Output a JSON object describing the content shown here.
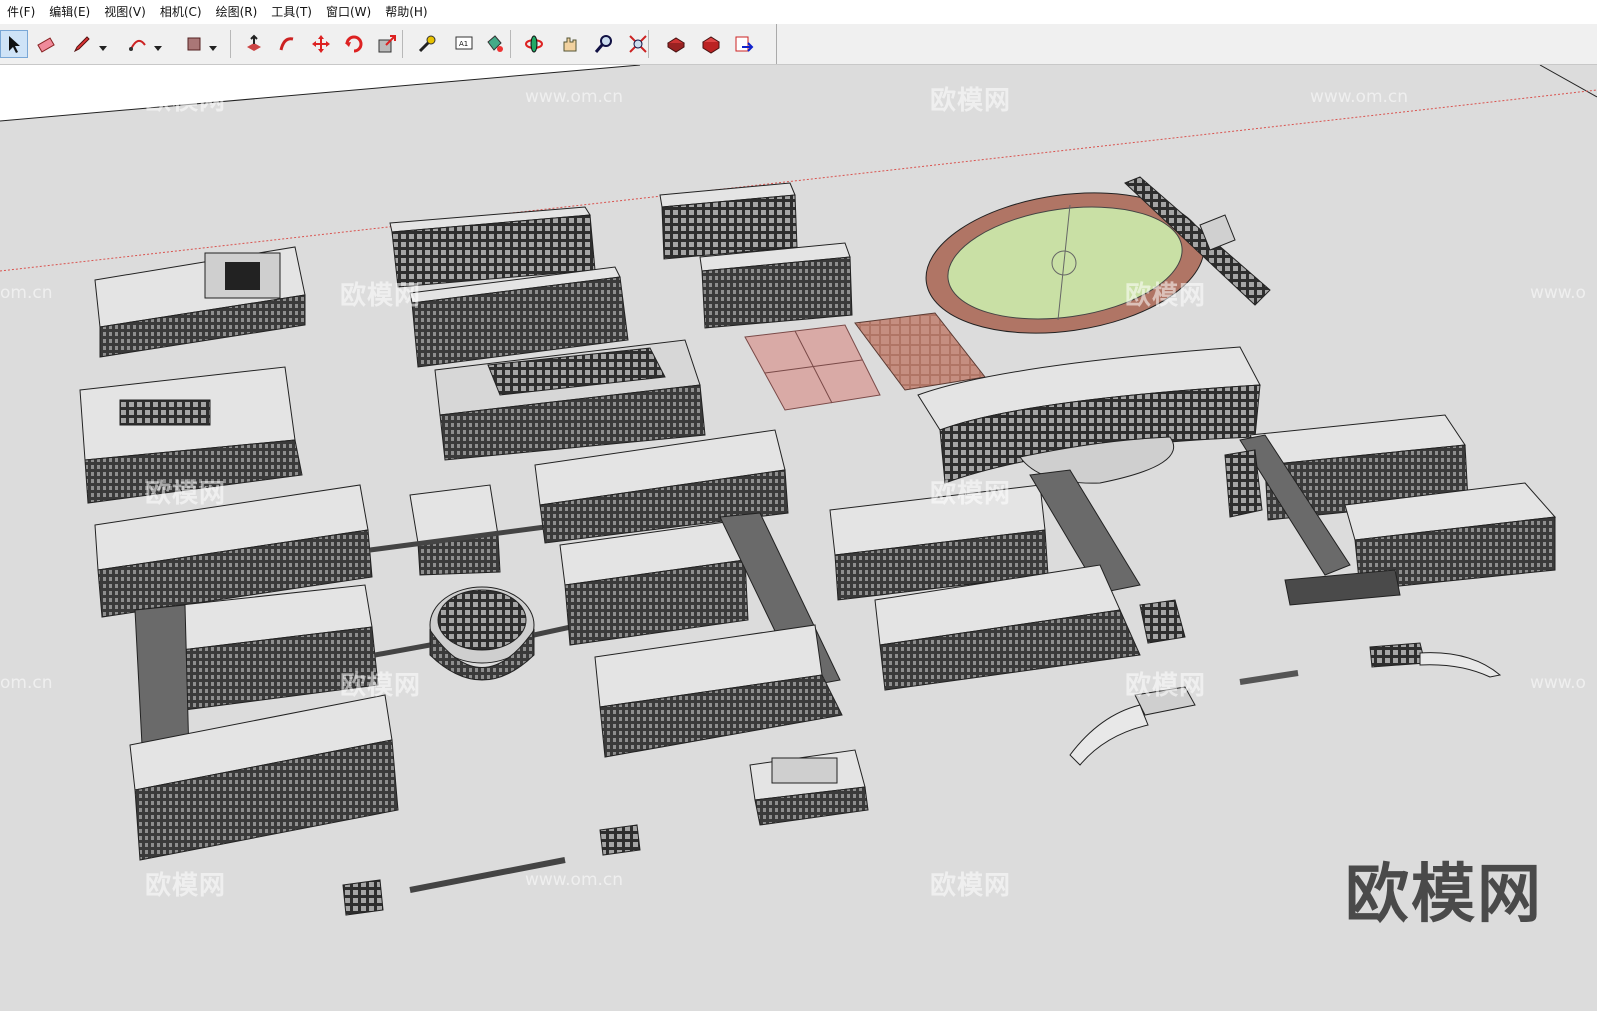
{
  "menu": [
    "件(F)",
    "编辑(E)",
    "视图(V)",
    "相机(C)",
    "绘图(R)",
    "工具(T)",
    "窗口(W)",
    "帮助(H)"
  ],
  "toolbar": {
    "tools": [
      "select-icon",
      "eraser-icon",
      "pencil-icon",
      "arc-icon",
      "rectangle-icon",
      "push-pull-icon",
      "follow-me-icon",
      "move-icon",
      "rotate-icon",
      "scale-icon",
      "tape-measure-icon",
      "text-icon",
      "paint-bucket-icon",
      "orbit-icon",
      "pan-icon",
      "zoom-icon",
      "zoom-extents-icon",
      "component-icon",
      "warehouse-icon",
      "export-icon"
    ],
    "active_tool": "select-icon",
    "text_tool_label": "A1"
  },
  "watermarks": {
    "brand": "欧模网",
    "url": "www.om.cn",
    "partial_url": "om.cn",
    "partial_url_right": "www.o",
    "big_logo": "欧模网"
  },
  "colors": {
    "ground": "#dcdcdc",
    "sky": "#ffffff",
    "axis_red": "#d9534f",
    "roof": "#e4e4e4",
    "facade": "#3a3a3a",
    "field_green": "#c9e0a5",
    "track": "#b07565",
    "court": "#d9aaa6"
  }
}
